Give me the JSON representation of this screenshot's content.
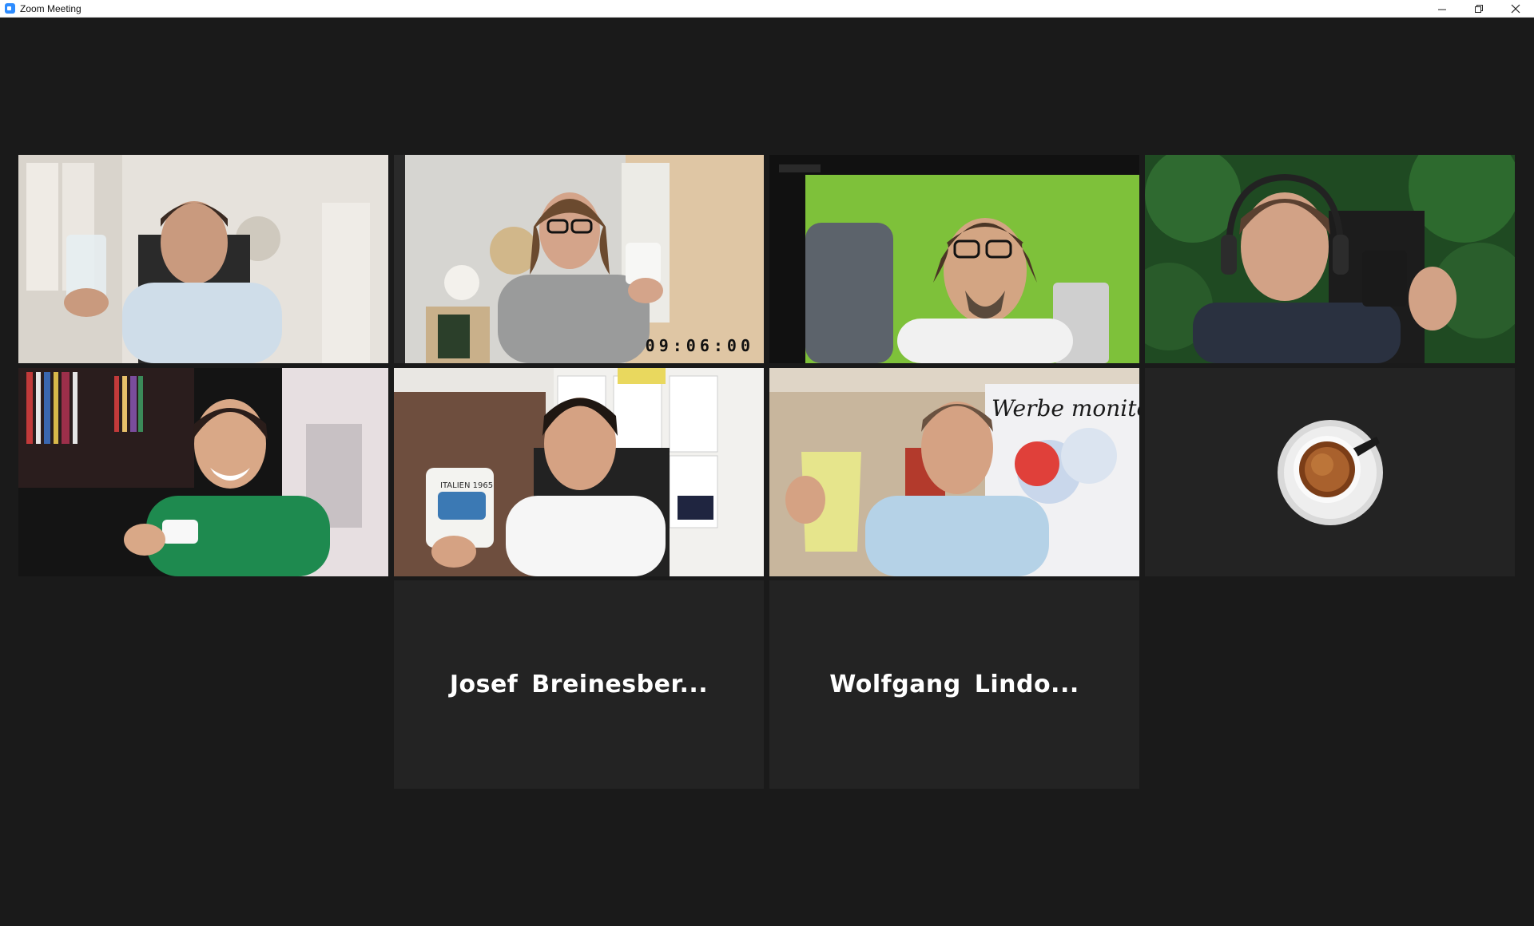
{
  "window": {
    "title": "Zoom Meeting",
    "controls": [
      "minimize-icon",
      "restore-icon",
      "close-icon"
    ]
  },
  "gallery": {
    "video_tiles": [
      {
        "id": "p1",
        "kind": "video",
        "prop": "water glass"
      },
      {
        "id": "p2",
        "kind": "video",
        "prop": "white mug",
        "overlay_timer": "09:06:00"
      },
      {
        "id": "p3",
        "kind": "video",
        "prop": "grey mug",
        "background": "green screen"
      },
      {
        "id": "p4",
        "kind": "video",
        "prop": "black mug",
        "background": "green foliage"
      },
      {
        "id": "p5",
        "kind": "video",
        "prop": "white coffee cup"
      },
      {
        "id": "p6",
        "kind": "video",
        "prop": "mug",
        "mug_text": "ITALIEN 1965"
      },
      {
        "id": "p7",
        "kind": "video",
        "prop": "yellow mug",
        "poster_text": "Werbe monitor"
      },
      {
        "id": "p8",
        "kind": "avatar",
        "avatar": "espresso-cup-icon"
      }
    ],
    "name_tiles": [
      {
        "id": "p9",
        "name": "Josef  Breinesber..."
      },
      {
        "id": "p10",
        "name": "Wolfgang  Lindo..."
      }
    ]
  },
  "colors": {
    "window_background": "#1a1a1a",
    "tile_background": "#232323",
    "titlebar": "#ffffff",
    "name_text": "#ffffff",
    "zoom_blue": "#2d8cff"
  }
}
